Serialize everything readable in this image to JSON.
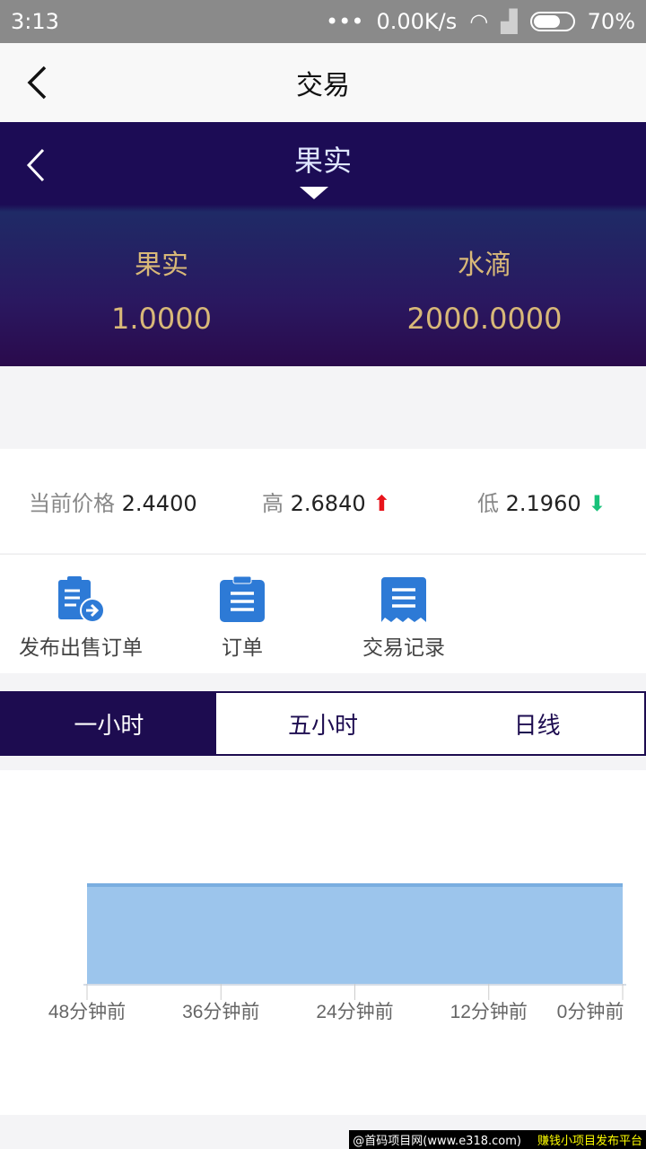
{
  "status_bar": {
    "time": "3:13",
    "dots": "•••",
    "speed": "0.00K/s",
    "battery": "70%"
  },
  "nav": {
    "title": "交易"
  },
  "hero": {
    "selector": "果实",
    "balances": [
      {
        "label": "果实",
        "value": "1.0000"
      },
      {
        "label": "水滴",
        "value": "2000.0000"
      }
    ]
  },
  "prices": {
    "current_label": "当前价格",
    "current": "2.4400",
    "high_label": "高",
    "high": "2.6840",
    "low_label": "低",
    "low": "2.1960",
    "up_color": "#e8141b",
    "down_color": "#18c27a"
  },
  "actions": [
    {
      "label": "发布出售订单",
      "icon": "clipboard-arrow-icon"
    },
    {
      "label": "订单",
      "icon": "clipboard-icon"
    },
    {
      "label": "交易记录",
      "icon": "receipt-icon"
    }
  ],
  "accent": "#1d0c50",
  "tabs": [
    {
      "label": "一小时",
      "active": true
    },
    {
      "label": "五小时",
      "active": false
    },
    {
      "label": "日线",
      "active": false
    }
  ],
  "chart_data": {
    "type": "area",
    "categories": [
      "48分钟前",
      "36分钟前",
      "24分钟前",
      "12分钟前",
      "0分钟前"
    ],
    "values": [
      1,
      1,
      1,
      1,
      1
    ],
    "fill": "#9cc5ec",
    "line": "#7aaee0"
  },
  "watermark": {
    "left": "@首码项目网(www.e318.com)",
    "right": "赚钱小项目发布平台"
  }
}
